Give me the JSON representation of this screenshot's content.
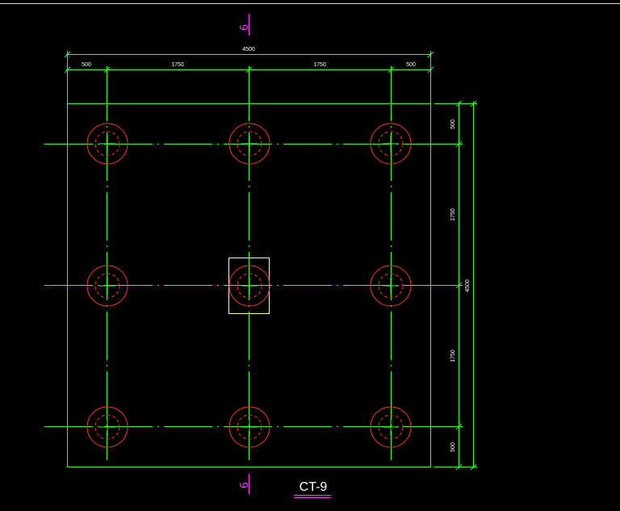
{
  "drawing": {
    "title": "CT-9",
    "axis_tag": "9",
    "dims_top": {
      "total": "4500",
      "seg1": "500",
      "seg2": "1750",
      "seg3": "1750",
      "seg4": "500"
    },
    "dims_right": {
      "total": "4500",
      "seg1": "500",
      "seg2": "1750",
      "seg3": "1750",
      "seg4": "500"
    },
    "colors": {
      "outline": "#33ff33",
      "pile": "#ff3333",
      "column": "#ffff99",
      "axis_tag": "#ff33ff",
      "text": "#ffffff",
      "title_underline": "#ff33ff"
    }
  }
}
